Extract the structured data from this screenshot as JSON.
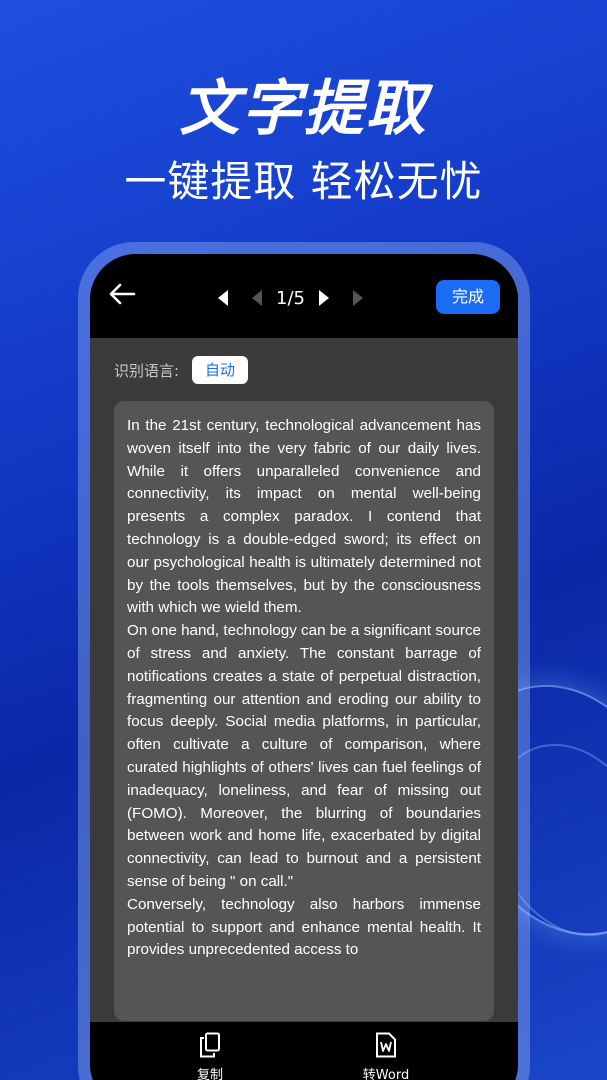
{
  "hero": {
    "title": "文字提取",
    "subtitle": "一键提取 轻松无忧"
  },
  "topbar": {
    "back_icon": "arrow-left-icon",
    "page_indicator": "1/5",
    "done_label": "完成"
  },
  "language": {
    "label": "识别语言:",
    "value": "自动"
  },
  "recognized_text": [
    "In the 21st century, technological advancement has woven itself into the very fabric of our daily lives. While it offers unparalleled convenience and connectivity, its impact on mental well-being presents a complex paradox. I contend that technology is a double-edged sword; its effect on our psychological health is ultimately determined not by the tools themselves, but by the consciousness with which we wield them.",
    "On one hand, technology can be a significant source of stress and anxiety. The constant barrage of notifications creates a state of perpetual distraction, fragmenting our attention and eroding our ability to focus deeply. Social media platforms, in particular, often cultivate a culture of comparison, where curated highlights of others' lives can fuel feelings of inadequacy, loneliness, and fear of missing out (FOMO). Moreover, the blurring of boundaries between work and home life, exacerbated by digital connectivity, can lead to burnout and a persistent sense of being \" on call.\"",
    "Conversely, technology also harbors immense potential to support and enhance mental health. It provides unprecedented access to"
  ],
  "bottombar": {
    "copy_label": "复制",
    "word_label": "转Word"
  },
  "colors": {
    "accent": "#1b6cf5",
    "background": "#1238c4",
    "card": "#555555"
  }
}
